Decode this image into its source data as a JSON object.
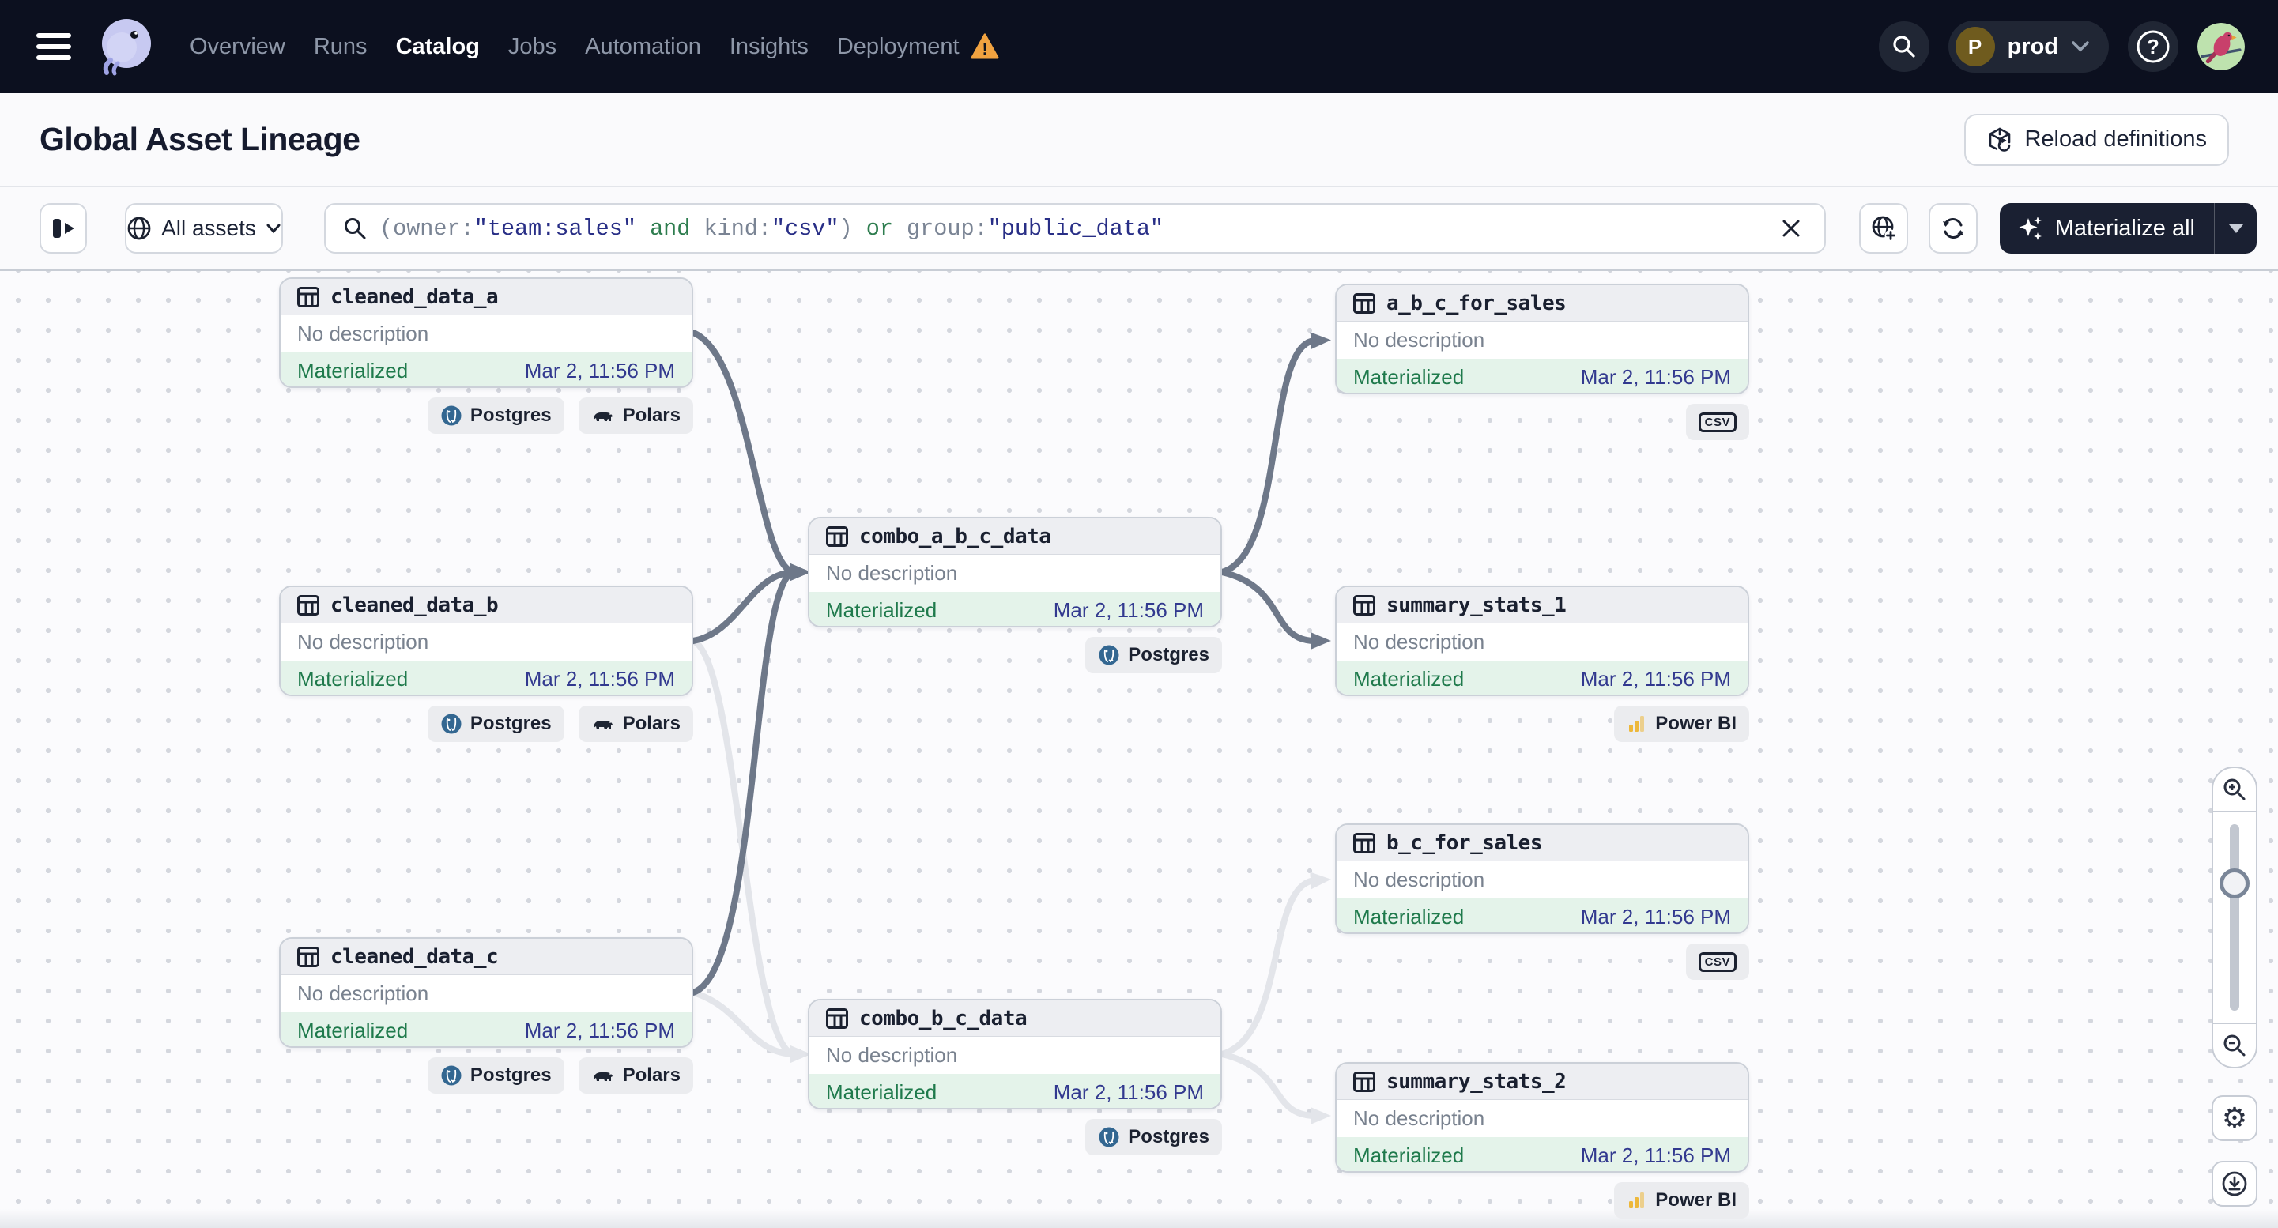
{
  "nav": {
    "items": [
      {
        "label": "Overview"
      },
      {
        "label": "Runs"
      },
      {
        "label": "Catalog",
        "active": true
      },
      {
        "label": "Jobs"
      },
      {
        "label": "Automation"
      },
      {
        "label": "Insights"
      },
      {
        "label": "Deployment",
        "warning": true
      }
    ],
    "warning_glyph": "!"
  },
  "account": {
    "initial": "P",
    "name": "prod",
    "help_glyph": "?"
  },
  "page": {
    "title": "Global Asset Lineage",
    "reload_button": "Reload definitions"
  },
  "toolbar": {
    "scope_label": "All assets",
    "materialize_label": "Materialize all",
    "query_tokens": [
      {
        "text": "(owner:",
        "kind": "plain"
      },
      {
        "text": "\"team:sales\"",
        "kind": "string"
      },
      {
        "text": " and ",
        "kind": "operator"
      },
      {
        "text": "kind:",
        "kind": "plain"
      },
      {
        "text": "\"csv\"",
        "kind": "string"
      },
      {
        "text": ") ",
        "kind": "plain"
      },
      {
        "text": "or",
        "kind": "operator"
      },
      {
        "text": " group:",
        "kind": "plain"
      },
      {
        "text": "\"public_data\"",
        "kind": "string"
      }
    ]
  },
  "graph": {
    "nodes": [
      {
        "title": "cleaned_data_a",
        "description": "No description",
        "status": "Materialized",
        "materialized_at": "Mar 2, 11:56 PM",
        "tags": [
          {
            "type": "postgres",
            "label": "Postgres"
          },
          {
            "type": "polars",
            "label": "Polars"
          }
        ]
      },
      {
        "title": "cleaned_data_b",
        "description": "No description",
        "status": "Materialized",
        "materialized_at": "Mar 2, 11:56 PM",
        "tags": [
          {
            "type": "postgres",
            "label": "Postgres"
          },
          {
            "type": "polars",
            "label": "Polars"
          }
        ]
      },
      {
        "title": "cleaned_data_c",
        "description": "No description",
        "status": "Materialized",
        "materialized_at": "Mar 2, 11:56 PM",
        "tags": [
          {
            "type": "postgres",
            "label": "Postgres"
          },
          {
            "type": "polars",
            "label": "Polars"
          }
        ]
      },
      {
        "title": "combo_a_b_c_data",
        "description": "No description",
        "status": "Materialized",
        "materialized_at": "Mar 2, 11:56 PM",
        "tags": [
          {
            "type": "postgres",
            "label": "Postgres"
          }
        ]
      },
      {
        "title": "combo_b_c_data",
        "description": "No description",
        "status": "Materialized",
        "materialized_at": "Mar 2, 11:56 PM",
        "tags": [
          {
            "type": "postgres",
            "label": "Postgres"
          }
        ]
      },
      {
        "title": "a_b_c_for_sales",
        "description": "No description",
        "status": "Materialized",
        "materialized_at": "Mar 2, 11:56 PM",
        "tags": [
          {
            "type": "csv",
            "label": "CSV"
          }
        ]
      },
      {
        "title": "summary_stats_1",
        "description": "No description",
        "status": "Materialized",
        "materialized_at": "Mar 2, 11:56 PM",
        "tags": [
          {
            "type": "powerbi",
            "label": "Power BI"
          }
        ]
      },
      {
        "title": "b_c_for_sales",
        "description": "No description",
        "status": "Materialized",
        "materialized_at": "Mar 2, 11:56 PM",
        "tags": [
          {
            "type": "csv",
            "label": "CSV"
          }
        ]
      },
      {
        "title": "summary_stats_2",
        "description": "No description",
        "status": "Materialized",
        "materialized_at": "Mar 2, 11:56 PM",
        "tags": [
          {
            "type": "powerbi",
            "label": "Power BI"
          }
        ]
      }
    ],
    "edges": [
      {
        "from": "cleaned_data_a",
        "to": "combo_a_b_c_data",
        "highlighted": true
      },
      {
        "from": "cleaned_data_b",
        "to": "combo_a_b_c_data",
        "highlighted": true
      },
      {
        "from": "cleaned_data_c",
        "to": "combo_a_b_c_data",
        "highlighted": true
      },
      {
        "from": "combo_a_b_c_data",
        "to": "a_b_c_for_sales",
        "highlighted": true
      },
      {
        "from": "combo_a_b_c_data",
        "to": "summary_stats_1",
        "highlighted": true
      },
      {
        "from": "cleaned_data_b",
        "to": "combo_b_c_data",
        "highlighted": false
      },
      {
        "from": "cleaned_data_c",
        "to": "combo_b_c_data",
        "highlighted": false
      },
      {
        "from": "combo_b_c_data",
        "to": "b_c_for_sales",
        "highlighted": false
      },
      {
        "from": "combo_b_c_data",
        "to": "summary_stats_2",
        "highlighted": false
      }
    ]
  },
  "colors": {
    "navbar_bg": "#0C101F",
    "accent_green": "#1F7A4C",
    "status_bg": "#E4F3EA",
    "timestamp_blue": "#32398F",
    "edge_dark": "#6E7889",
    "edge_light": "#E3E5EA",
    "warning_orange": "#F2A340",
    "materialize_bg": "#1A2032"
  },
  "icons": {
    "nav_menu": "hamburger-icon",
    "logo": "dagster-logo-icon",
    "deployment_warning": "warning-triangle-icon",
    "search": "search-icon",
    "help": "help-icon",
    "user": "avatar-bird-image",
    "reload": "reload-cube-icon",
    "panel_toggle": "expand-panel-icon",
    "scope": "globe-icon",
    "clear": "close-icon",
    "add_scope": "globe-plus-icon",
    "refresh": "refresh-icon",
    "materialize": "sparkle-icon",
    "asset": "table-icon",
    "zoom_in": "zoom-in-icon",
    "zoom_out": "zoom-out-icon",
    "settings": "gear-icon",
    "download": "download-icon",
    "postgres": "postgres-icon",
    "polars": "polars-icon",
    "powerbi": "powerbi-icon",
    "csv": "csv-badge-icon"
  }
}
